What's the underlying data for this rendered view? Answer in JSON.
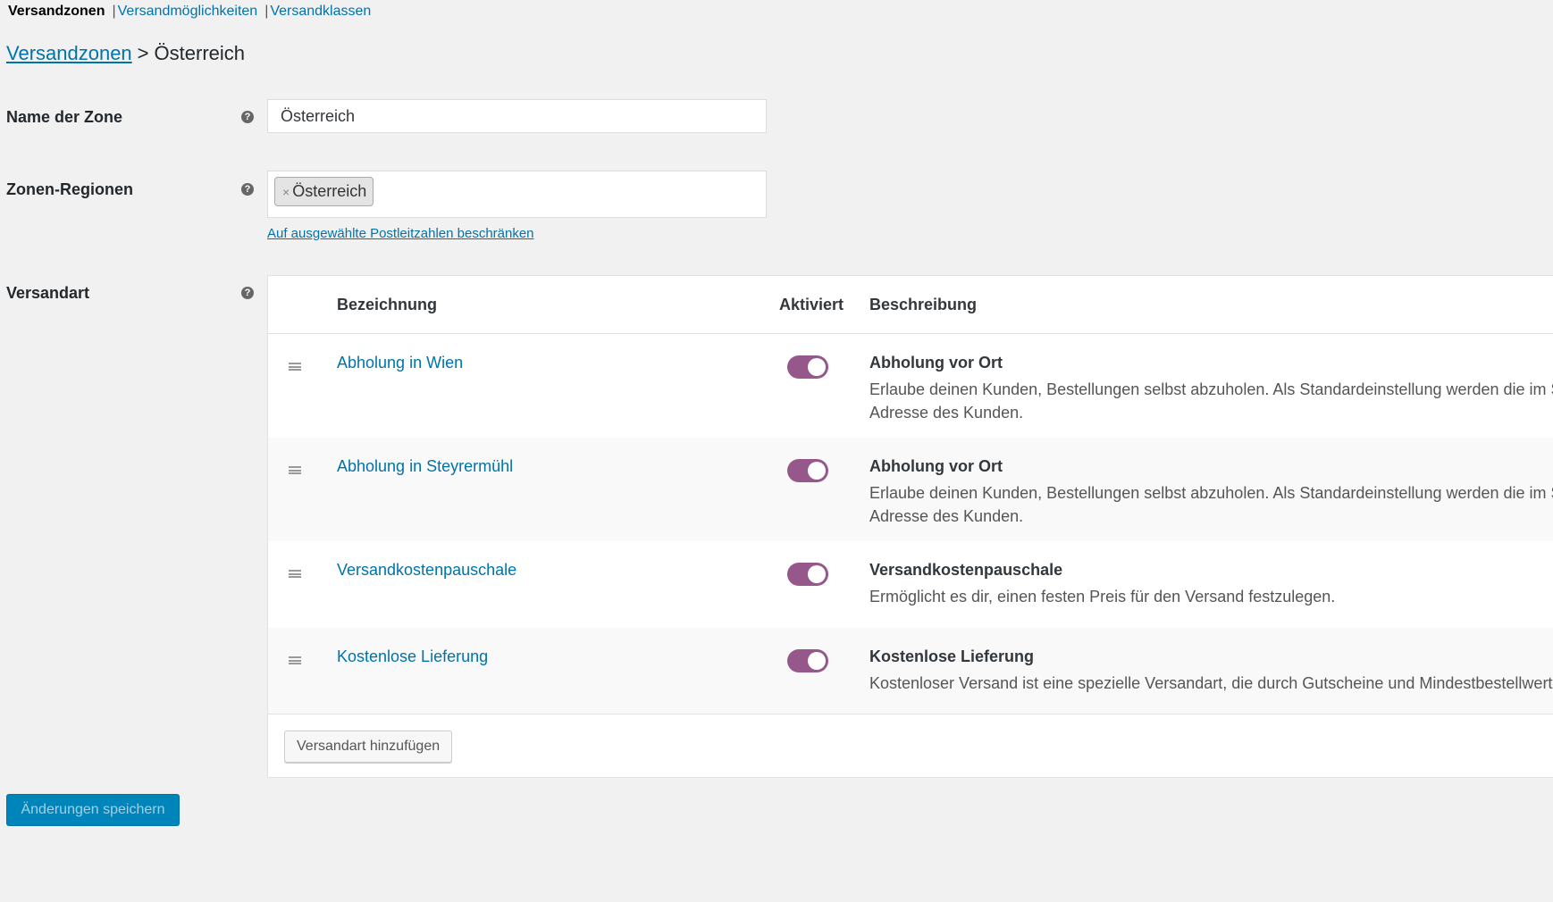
{
  "tabs": {
    "current": "Versandzonen",
    "links": [
      "Versandmöglichkeiten",
      "Versandklassen"
    ]
  },
  "breadcrumb": {
    "link": "Versandzonen",
    "separator": ">",
    "current": "Österreich"
  },
  "form": {
    "zone_name_label": "Name der Zone",
    "zone_name_value": "Österreich",
    "regions_label": "Zonen-Regionen",
    "regions_chip": "Österreich",
    "regions_chip_remove": "×",
    "postcode_link": "Auf ausgewählte Postleitzahlen beschränken",
    "methods_label": "Versandart",
    "help_glyph": "?"
  },
  "methods_table": {
    "headers": {
      "title": "Bezeichnung",
      "enabled": "Aktiviert",
      "description": "Beschreibung"
    },
    "rows": [
      {
        "title": "Abholung in Wien",
        "enabled": true,
        "desc_title": "Abholung vor Ort",
        "desc_line1": "Erlaube deinen Kunden, Bestellungen selbst abzuholen. Als Standardeinstellung werden die im Shop",
        "desc_line2": "Adresse des Kunden."
      },
      {
        "title": "Abholung in Steyrermühl",
        "enabled": true,
        "desc_title": "Abholung vor Ort",
        "desc_line1": "Erlaube deinen Kunden, Bestellungen selbst abzuholen. Als Standardeinstellung werden die im Shop",
        "desc_line2": "Adresse des Kunden."
      },
      {
        "title": "Versandkostenpauschale",
        "enabled": true,
        "desc_title": "Versandkostenpauschale",
        "desc_line1": "Ermöglicht es dir, einen festen Preis für den Versand festzulegen.",
        "desc_line2": ""
      },
      {
        "title": "Kostenlose Lieferung",
        "enabled": true,
        "desc_title": "Kostenlose Lieferung",
        "desc_line1": "Kostenloser Versand ist eine spezielle Versandart, die durch Gutscheine und Mindestbestellwerte au",
        "desc_line2": ""
      }
    ],
    "add_button": "Versandart hinzufügen"
  },
  "save_button": "Änderungen speichern",
  "colors": {
    "link": "#0073aa",
    "toggle_on": "#96588a",
    "primary_button": "#0085ba",
    "background": "#f1f1f1"
  }
}
